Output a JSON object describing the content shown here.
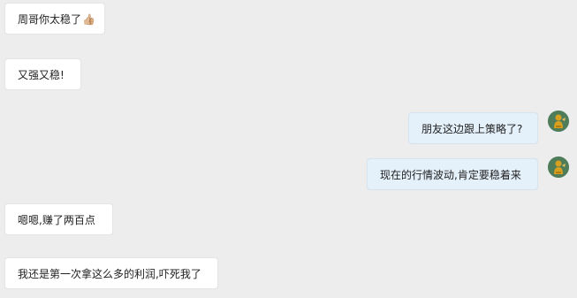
{
  "chat": {
    "messages": [
      {
        "side": "in",
        "text": "周哥你太稳了",
        "emoji": "👍🏼"
      },
      {
        "side": "in",
        "text": "又强又稳!"
      },
      {
        "side": "out",
        "text": "朋友这边跟上策略了?"
      },
      {
        "side": "out",
        "text": "现在的行情波动,肯定要稳着来"
      },
      {
        "side": "in",
        "text": "嗯嗯,赚了两百点"
      },
      {
        "side": "in",
        "text": "我还是第一次拿这么多的利润,吓死我了"
      }
    ]
  },
  "avatar": {
    "icon": "golden-figure-avatar-icon",
    "bg_color": "#4f7d5a",
    "figure_color": "#d8a020"
  },
  "colors": {
    "background": "#ededed",
    "incoming_bubble": "#ffffff",
    "outgoing_bubble": "#e4f0fa"
  }
}
